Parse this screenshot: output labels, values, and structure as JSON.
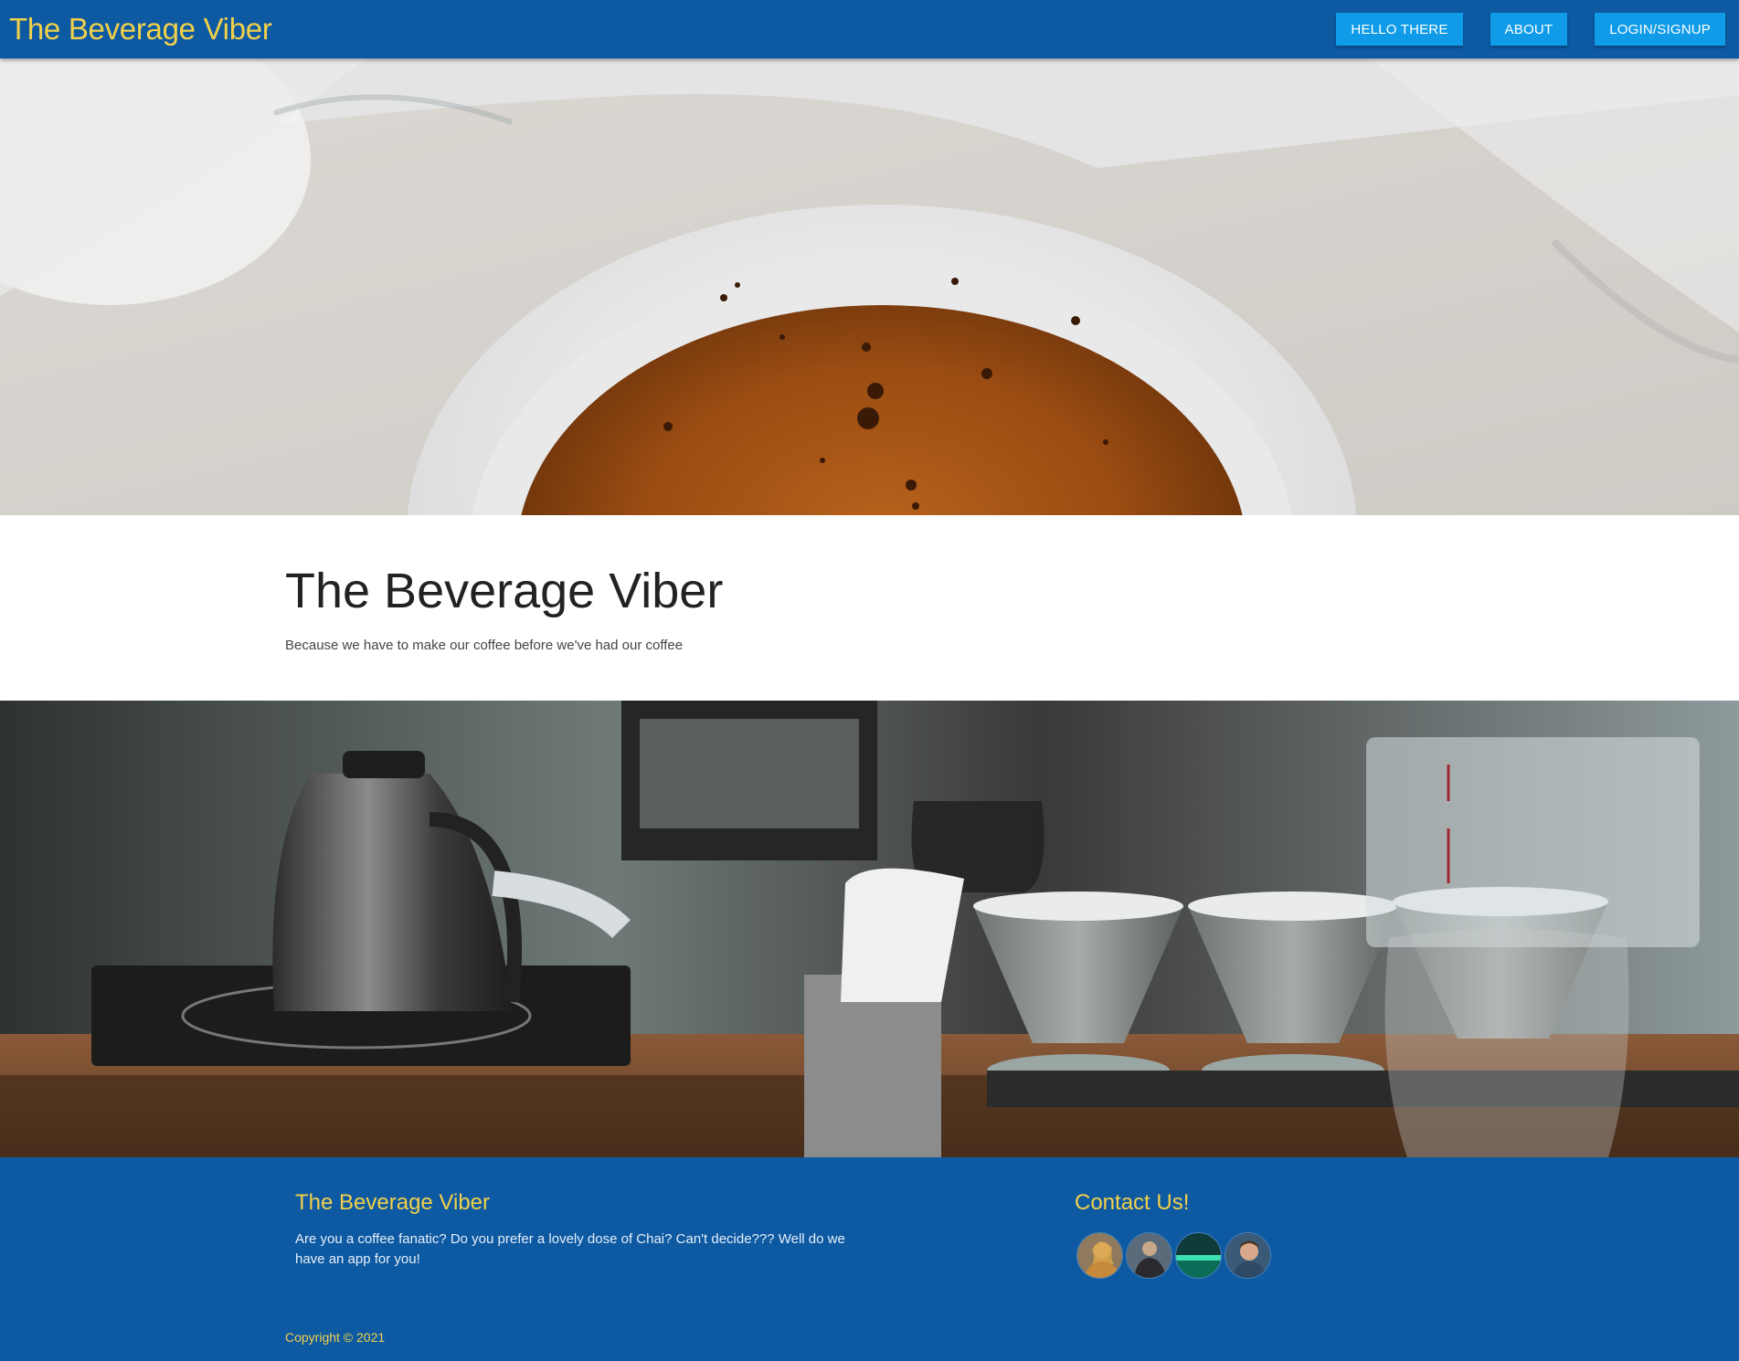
{
  "navbar": {
    "brand": "The Beverage Viber",
    "buttons": [
      "HELLO THERE",
      "ABOUT",
      "LOGIN/SIGNUP"
    ]
  },
  "intro": {
    "title": "The Beverage Viber",
    "subtitle": "Because we have to make our coffee before we've had our coffee"
  },
  "footer": {
    "title": "The Beverage Viber",
    "text": "Are you a coffee fanatic? Do you prefer a lovely dose of Chai? Can't decide??? Well do we have an app for you!",
    "contact_title": "Contact Us!",
    "avatars": [
      "avatar-1",
      "avatar-2",
      "avatar-3",
      "avatar-4"
    ],
    "copyright": "Copyright © 2021"
  },
  "colors": {
    "navbar_bg": "#0d5aa3",
    "brand_yellow": "#f2d04a",
    "button_bg": "#0f9be8"
  }
}
